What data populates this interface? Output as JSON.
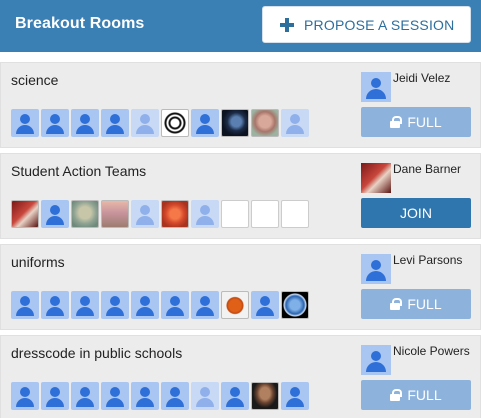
{
  "header": {
    "title": "Breakout Rooms",
    "propose_label": "PROPOSE A SESSION",
    "propose_icon": "plus-icon",
    "accent": "#3a80b5"
  },
  "rooms": [
    {
      "name": "science",
      "host": "Jeidi Velez",
      "host_avatar": "user",
      "action": "FULL",
      "action_type": "full",
      "seats": [
        "user",
        "user",
        "user",
        "user",
        "user-faded",
        "photo-emblem",
        "user",
        "photo-dark-blue",
        "photo-skin",
        "user-faded"
      ]
    },
    {
      "name": "Student Action Teams",
      "host": "Dane Barner",
      "host_avatar": "photo-red",
      "action": "JOIN",
      "action_type": "join",
      "seats": [
        "photo-red",
        "user",
        "photo-sage",
        "photo-sunset",
        "user-faded",
        "photo-flame",
        "user-faded",
        "empty",
        "empty",
        "empty"
      ]
    },
    {
      "name": "uniforms",
      "host": "Levi Parsons",
      "host_avatar": "user",
      "action": "FULL",
      "action_type": "full",
      "seats": [
        "user",
        "user",
        "user",
        "user",
        "user",
        "user",
        "user",
        "photo-crest",
        "user",
        "photo-globe"
      ]
    },
    {
      "name": "dresscode in public schools",
      "host": "Nicole Powers",
      "host_avatar": "user",
      "action": "FULL",
      "action_type": "full",
      "seats": [
        "user",
        "user",
        "user",
        "user",
        "user",
        "user",
        "user-faded",
        "user",
        "photo-portrait",
        "user"
      ]
    }
  ]
}
